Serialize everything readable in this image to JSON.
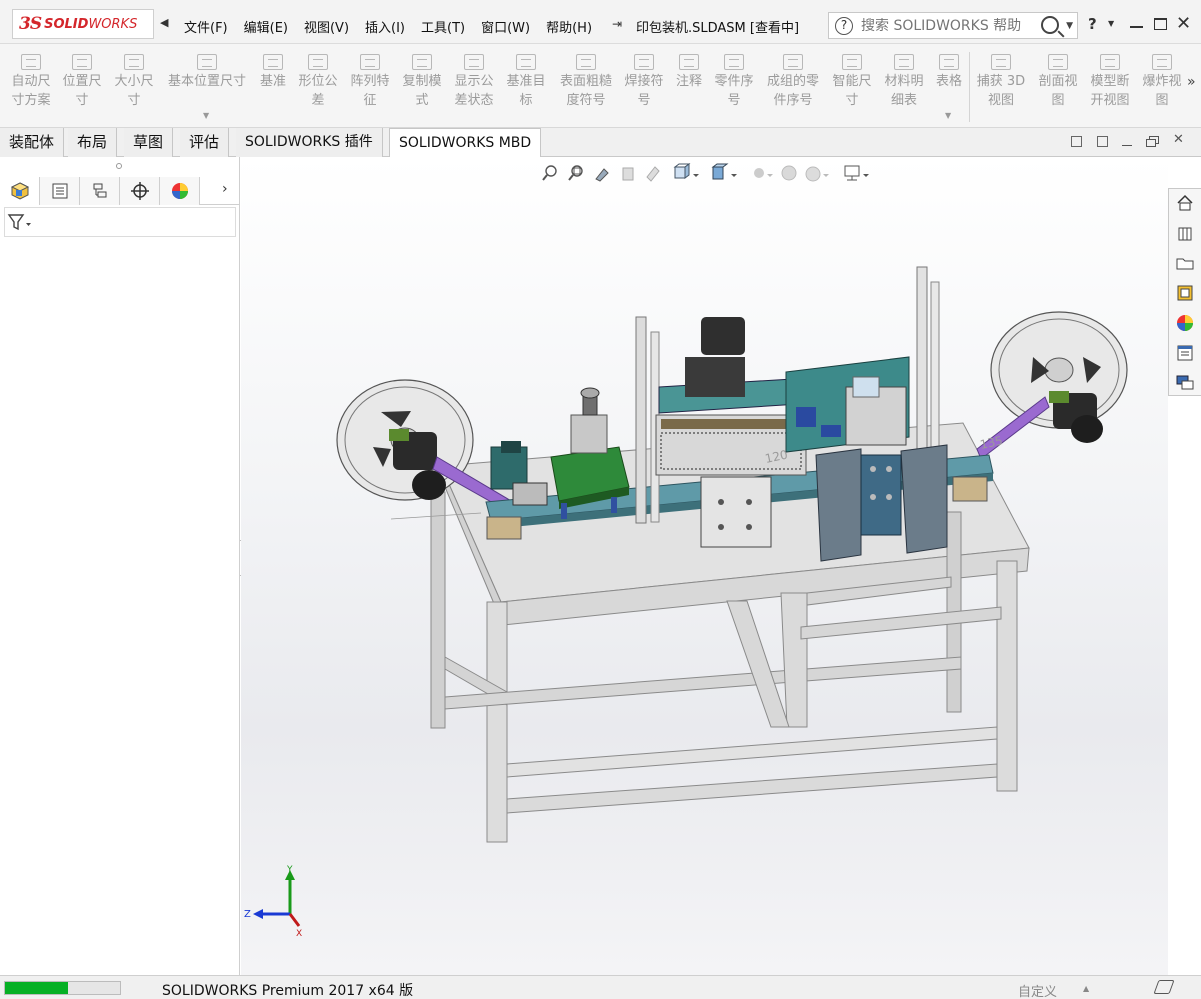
{
  "app": {
    "logo_prefix": "3S",
    "logo_bold": "SOLID",
    "logo_rest": "WORKS",
    "doc_title": "印包装机.SLDASM [查看中]"
  },
  "menus": [
    "文件(F)",
    "编辑(E)",
    "视图(V)",
    "插入(I)",
    "工具(T)",
    "窗口(W)",
    "帮助(H)"
  ],
  "help_search": {
    "placeholder": "搜索 SOLIDWORKS 帮助",
    "q_glyph": "?"
  },
  "window_help": "?",
  "toolbar": {
    "items": [
      {
        "l1": "自动尺",
        "l2": "寸方案",
        "icon": "auto-dimension-scheme-icon"
      },
      {
        "l1": "位置尺",
        "l2": "寸",
        "icon": "location-dimension-icon"
      },
      {
        "l1": "大小尺",
        "l2": "寸",
        "icon": "size-dimension-icon"
      },
      {
        "l1": "基本位置尺寸",
        "l2": "",
        "icon": "basic-location-dimension-icon"
      },
      {
        "l1": "基准",
        "l2": "",
        "icon": "datum-icon"
      },
      {
        "l1": "形位公",
        "l2": "差",
        "icon": "geometric-tolerance-icon"
      },
      {
        "l1": "阵列特",
        "l2": "征",
        "icon": "pattern-feature-icon"
      },
      {
        "l1": "复制模",
        "l2": "式",
        "icon": "copy-scheme-icon"
      },
      {
        "l1": "显示公",
        "l2": "差状态",
        "icon": "show-tolerance-status-icon"
      },
      {
        "l1": "基准目",
        "l2": "标",
        "icon": "datum-target-icon"
      },
      {
        "l1": "表面粗糙",
        "l2": "度符号",
        "icon": "surface-finish-icon"
      },
      {
        "l1": "焊接符",
        "l2": "号",
        "icon": "weld-symbol-icon"
      },
      {
        "l1": "注释",
        "l2": "",
        "icon": "note-icon"
      },
      {
        "l1": "零件序",
        "l2": "号",
        "icon": "balloon-icon"
      },
      {
        "l1": "成组的零",
        "l2": "件序号",
        "icon": "stacked-balloon-icon"
      },
      {
        "l1": "智能尺",
        "l2": "寸",
        "icon": "smart-dimension-icon"
      },
      {
        "l1": "材料明",
        "l2": "细表",
        "icon": "bom-icon"
      },
      {
        "l1": "表格",
        "l2": "",
        "icon": "table-icon"
      },
      {
        "l1": "捕获 3D",
        "l2": "视图",
        "icon": "capture-3d-view-icon"
      },
      {
        "l1": "剖面视",
        "l2": "图",
        "icon": "section-view-icon"
      },
      {
        "l1": "模型断",
        "l2": "开视图",
        "icon": "model-break-view-icon"
      },
      {
        "l1": "爆炸视",
        "l2": "图",
        "icon": "exploded-view-icon"
      }
    ],
    "more_glyph": "»"
  },
  "tabs": [
    "装配体",
    "布局",
    "草图",
    "评估",
    "SOLIDWORKS 插件",
    "SOLIDWORKS MBD"
  ],
  "active_tab": "SOLIDWORKS MBD",
  "feature_manager": {
    "tabs": [
      "feature-manager-icon",
      "property-manager-icon",
      "configuration-manager-icon",
      "dimxpert-manager-icon",
      "display-manager-icon"
    ],
    "more_glyph": "›",
    "filter_icon": "filter-icon"
  },
  "task_pane": [
    "home-icon",
    "design-library-icon",
    "file-explorer-icon",
    "view-palette-icon",
    "appearances-icon",
    "custom-properties-icon",
    "forum-icon"
  ],
  "triad": {
    "y": "Y",
    "z": "Z",
    "x": "X"
  },
  "dims": {
    "d1": "120",
    "d2": "135"
  },
  "status": {
    "progress": 0.55,
    "text": "SOLIDWORKS Premium 2017 x64 版",
    "custom": "自定义",
    "up_glyph": "▲"
  },
  "colors": {
    "accent_red": "#d4262b",
    "progress_green": "#06b025",
    "frame_gray": "#dcdcdc",
    "machine_teal": "#3d8a8a",
    "belt_purple": "#9a6ad0"
  }
}
